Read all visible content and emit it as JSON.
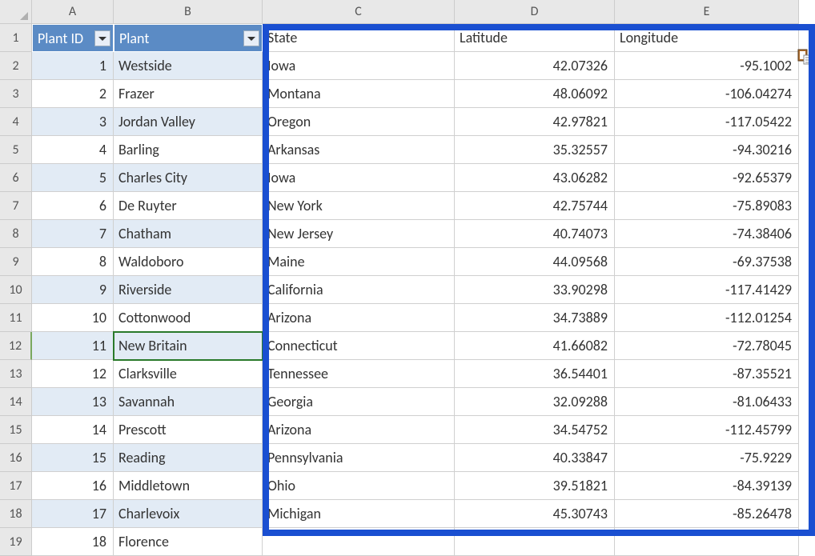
{
  "columns": [
    "A",
    "B",
    "C",
    "D",
    "E"
  ],
  "headers": {
    "plant_id": "Plant ID",
    "plant": "Plant",
    "state": "State",
    "latitude": "Latitude",
    "longitude": "Longitude"
  },
  "rows": [
    {
      "n": 1,
      "id": "1",
      "plant": "Westside",
      "state": "Iowa",
      "lat": "42.07326",
      "lon": "-95.1002"
    },
    {
      "n": 2,
      "id": "2",
      "plant": "Frazer",
      "state": "Montana",
      "lat": "48.06092",
      "lon": "-106.04274"
    },
    {
      "n": 3,
      "id": "3",
      "plant": "Jordan Valley",
      "state": "Oregon",
      "lat": "42.97821",
      "lon": "-117.05422"
    },
    {
      "n": 4,
      "id": "4",
      "plant": "Barling",
      "state": "Arkansas",
      "lat": "35.32557",
      "lon": "-94.30216"
    },
    {
      "n": 5,
      "id": "5",
      "plant": "Charles City",
      "state": "Iowa",
      "lat": "43.06282",
      "lon": "-92.65379"
    },
    {
      "n": 6,
      "id": "6",
      "plant": "De Ruyter",
      "state": "New York",
      "lat": "42.75744",
      "lon": "-75.89083"
    },
    {
      "n": 7,
      "id": "7",
      "plant": "Chatham",
      "state": "New Jersey",
      "lat": "40.74073",
      "lon": "-74.38406"
    },
    {
      "n": 8,
      "id": "8",
      "plant": "Waldoboro",
      "state": "Maine",
      "lat": "44.09568",
      "lon": "-69.37538"
    },
    {
      "n": 9,
      "id": "9",
      "plant": "Riverside",
      "state": "California",
      "lat": "33.90298",
      "lon": "-117.41429"
    },
    {
      "n": 10,
      "id": "10",
      "plant": "Cottonwood",
      "state": "Arizona",
      "lat": "34.73889",
      "lon": "-112.01254"
    },
    {
      "n": 11,
      "id": "11",
      "plant": "New Britain",
      "state": "Connecticut",
      "lat": "41.66082",
      "lon": "-72.78045"
    },
    {
      "n": 12,
      "id": "12",
      "plant": "Clarksville",
      "state": "Tennessee",
      "lat": "36.54401",
      "lon": "-87.35521"
    },
    {
      "n": 13,
      "id": "13",
      "plant": "Savannah",
      "state": "Georgia",
      "lat": "32.09288",
      "lon": "-81.06433"
    },
    {
      "n": 14,
      "id": "14",
      "plant": "Prescott",
      "state": "Arizona",
      "lat": "34.54752",
      "lon": "-112.45799"
    },
    {
      "n": 15,
      "id": "15",
      "plant": "Reading",
      "state": "Pennsylvania",
      "lat": "40.33847",
      "lon": "-75.9229"
    },
    {
      "n": 16,
      "id": "16",
      "plant": "Middletown",
      "state": "Ohio",
      "lat": "39.51821",
      "lon": "-84.39139"
    },
    {
      "n": 17,
      "id": "17",
      "plant": "Charlevoix",
      "state": "Michigan",
      "lat": "45.30743",
      "lon": "-85.26478"
    },
    {
      "n": 18,
      "id": "18",
      "plant": "Florence",
      "state": "",
      "lat": "",
      "lon": ""
    }
  ],
  "active_row": 12,
  "row_headers": [
    "1",
    "2",
    "3",
    "4",
    "5",
    "6",
    "7",
    "8",
    "9",
    "10",
    "11",
    "12",
    "13",
    "14",
    "15",
    "16",
    "17",
    "18",
    "19"
  ]
}
